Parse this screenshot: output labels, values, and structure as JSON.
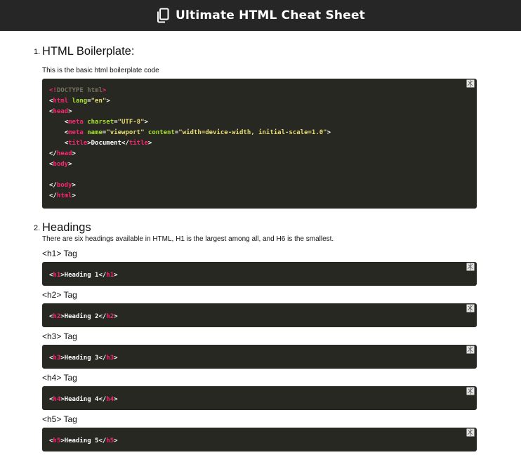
{
  "header": {
    "title": "Ultimate HTML Cheat Sheet",
    "icon": "copy-icon"
  },
  "sections": [
    {
      "number": "1.",
      "title": "HTML Boilerplate:",
      "description": "This is the basic html boilerplate code",
      "code": {
        "l1": {
          "a": "<!",
          "b": "DOCTYPE html",
          "c": ">"
        },
        "l2": {
          "a": "<",
          "b": "html",
          "c": " lang",
          "d": "=",
          "e": "\"en\"",
          "f": ">"
        },
        "l3": {
          "a": "<",
          "b": "head",
          "c": ">"
        },
        "l4": {
          "indent": "    ",
          "a": "<",
          "b": "meta",
          "c": " charset",
          "d": "=",
          "e": "\"UTF-8\"",
          "f": ">"
        },
        "l5": {
          "indent": "    ",
          "a": "<",
          "b": "meta",
          "c": " name",
          "d": "=",
          "e": "\"viewport\"",
          "f": " content",
          "g": "=",
          "h": "\"width=device-width, initial-scale=1.0\"",
          "i": ">"
        },
        "l6": {
          "indent": "    ",
          "a": "<",
          "b": "title",
          "c": ">Document</",
          "d": "title",
          "e": ">"
        },
        "l7": {
          "a": "</",
          "b": "head",
          "c": ">"
        },
        "l8": {
          "a": "<",
          "b": "body",
          "c": ">"
        },
        "l10": {
          "a": "</",
          "b": "body",
          "c": ">"
        },
        "l11": {
          "a": "</",
          "b": "html",
          "c": ">"
        }
      }
    },
    {
      "number": "2.",
      "title": "Headings",
      "description": "There are six headings available in HTML, H1 is the largest among all, and H6 is the smallest.",
      "tags": [
        {
          "label": "<h1> Tag",
          "open": "<",
          "tag": "h1",
          "text": ">Heading 1</",
          "close": ">"
        },
        {
          "label": "<h2> Tag",
          "open": "<",
          "tag": "h2",
          "text": ">Heading 2</",
          "close": ">"
        },
        {
          "label": "<h3> Tag",
          "open": "<",
          "tag": "h3",
          "text": ">Heading 3</",
          "close": ">"
        },
        {
          "label": "<h4> Tag",
          "open": "<",
          "tag": "h4",
          "text": ">Heading 4</",
          "close": ">"
        },
        {
          "label": "<h5> Tag",
          "open": "<",
          "tag": "h5",
          "text": ">Heading 5</",
          "close": ">"
        }
      ]
    }
  ],
  "colors": {
    "header_bg": "#262626",
    "code_bg": "#272822",
    "tag": "#f92672",
    "attr": "#a6e22e",
    "string": "#e6db74",
    "doctype": "#75715e"
  }
}
